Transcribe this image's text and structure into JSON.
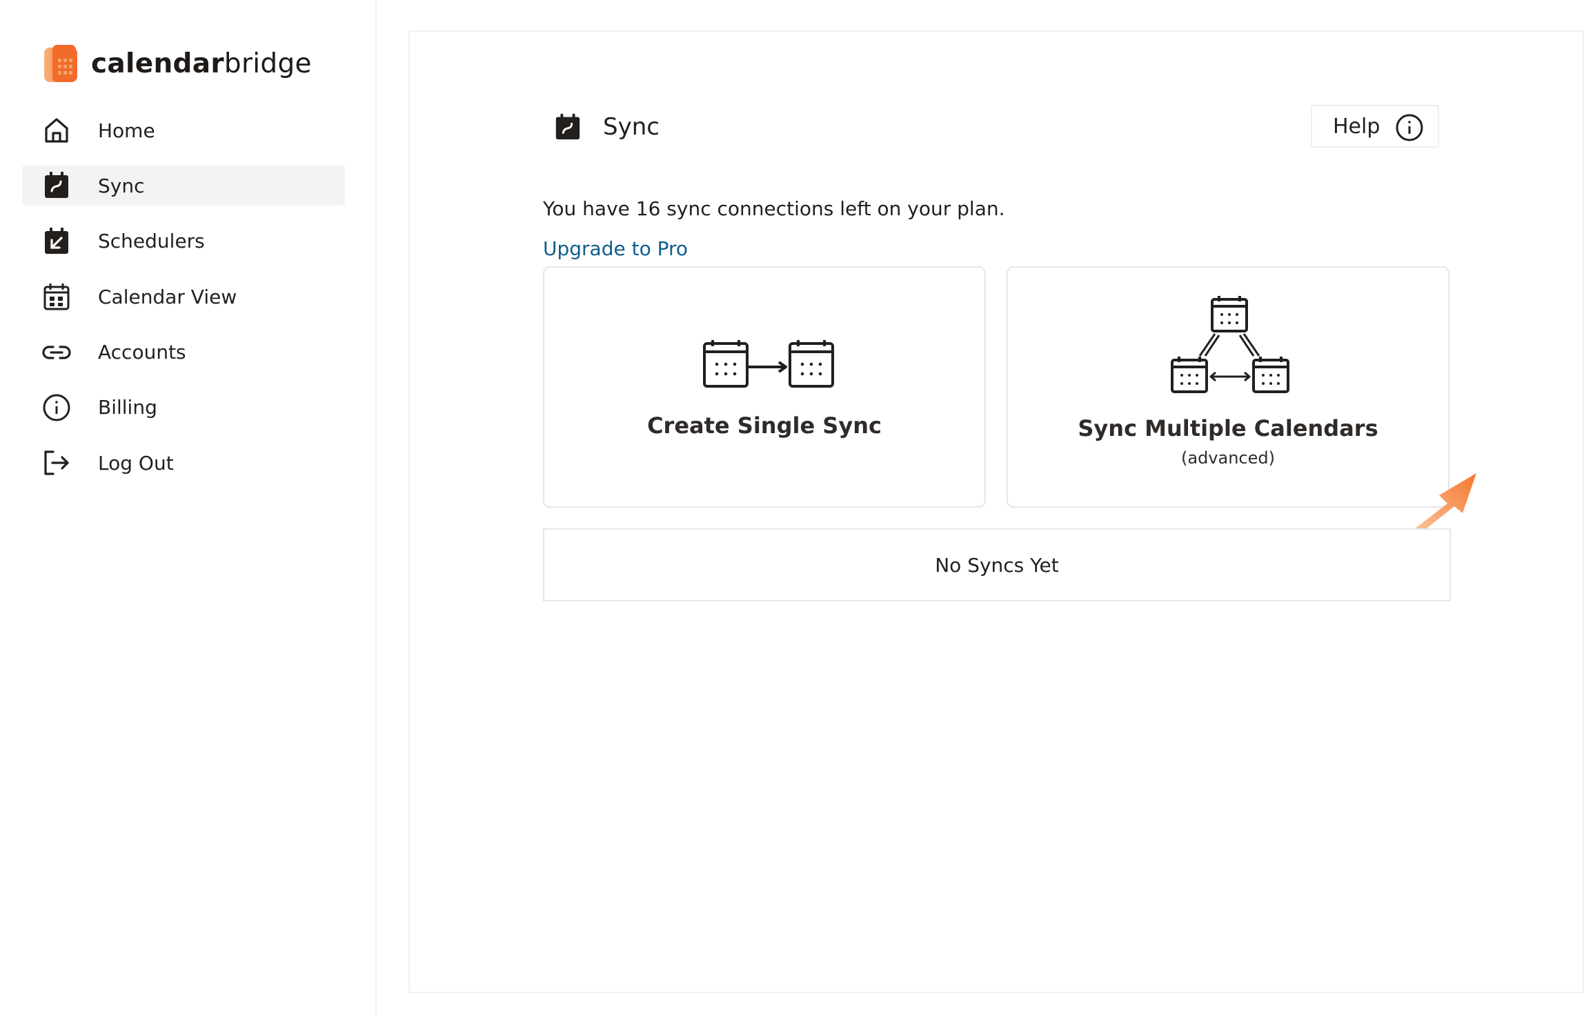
{
  "brand": {
    "name_bold": "calendar",
    "name_regular": "bridge",
    "accent_color": "#f07a3a"
  },
  "sidebar": {
    "items": [
      {
        "label": "Home",
        "icon": "home-icon",
        "active": false
      },
      {
        "label": "Sync",
        "icon": "sync-icon",
        "active": true
      },
      {
        "label": "Schedulers",
        "icon": "scheduler-icon",
        "active": false
      },
      {
        "label": "Calendar View",
        "icon": "calendar-icon",
        "active": false
      },
      {
        "label": "Accounts",
        "icon": "link-icon",
        "active": false
      },
      {
        "label": "Billing",
        "icon": "info-icon",
        "active": false
      },
      {
        "label": "Log Out",
        "icon": "logout-icon",
        "active": false
      }
    ]
  },
  "header": {
    "title": "Sync",
    "help_label": "Help"
  },
  "plan": {
    "text": "You have 16 sync connections left on your plan.",
    "upgrade_link": "Upgrade to Pro"
  },
  "cards": {
    "single": {
      "title": "Create Single Sync"
    },
    "multi": {
      "title": "Sync Multiple Calendars",
      "subtitle": "(advanced)"
    }
  },
  "syncs": {
    "empty_text": "No Syncs Yet"
  },
  "colors": {
    "link": "#0f5e8c",
    "text": "#231f1d",
    "active_bg": "#f3f3f3"
  }
}
